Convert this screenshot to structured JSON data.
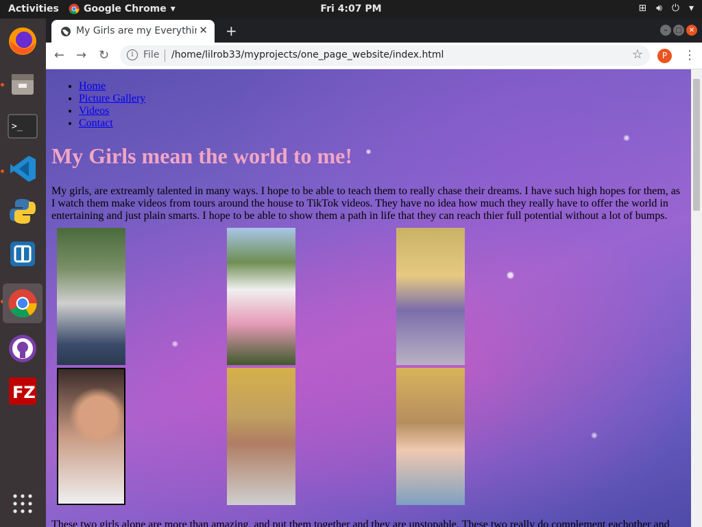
{
  "topbar": {
    "activities": "Activities",
    "app_name": "Google Chrome",
    "clock": "Fri  4:07 PM"
  },
  "dock": {
    "items": [
      "firefox-icon",
      "files-icon",
      "terminal-icon",
      "vscode-icon",
      "python-icon",
      "boxy-icon",
      "chrome-icon",
      "github-desktop-icon",
      "filezilla-icon",
      "app-grid-icon"
    ]
  },
  "browser": {
    "tab_title": "My Girls are my Everything",
    "address_scheme_label": "File",
    "address_url": "/home/lilrob33/myprojects/one_page_website/index.html",
    "profile_initial": "P"
  },
  "page": {
    "nav": [
      "Home",
      "Picture Gallery",
      "Videos",
      "Contact"
    ],
    "heading": "My Girls mean the world to me!",
    "paragraph1": "My girls, are extreamly talented in many ways. I hope to be able to teach them to really chase their dreams. I have such high hopes for them, as I watch them make videos from tours around the house to TikTok videos. They have no idea how much they really have to offer the world in entertaining and just plain smarts. I hope to be able to show them a path in life that they can reach thier full potential without a lot of bumps.",
    "paragraph2": "These two girls alone are more than amazing, and put them together and they are unstopable. These two really do complement eachother and"
  },
  "colors": {
    "heading": "#f2a6c4",
    "link": "#0000ee",
    "ubuntu_accent": "#e95420"
  }
}
